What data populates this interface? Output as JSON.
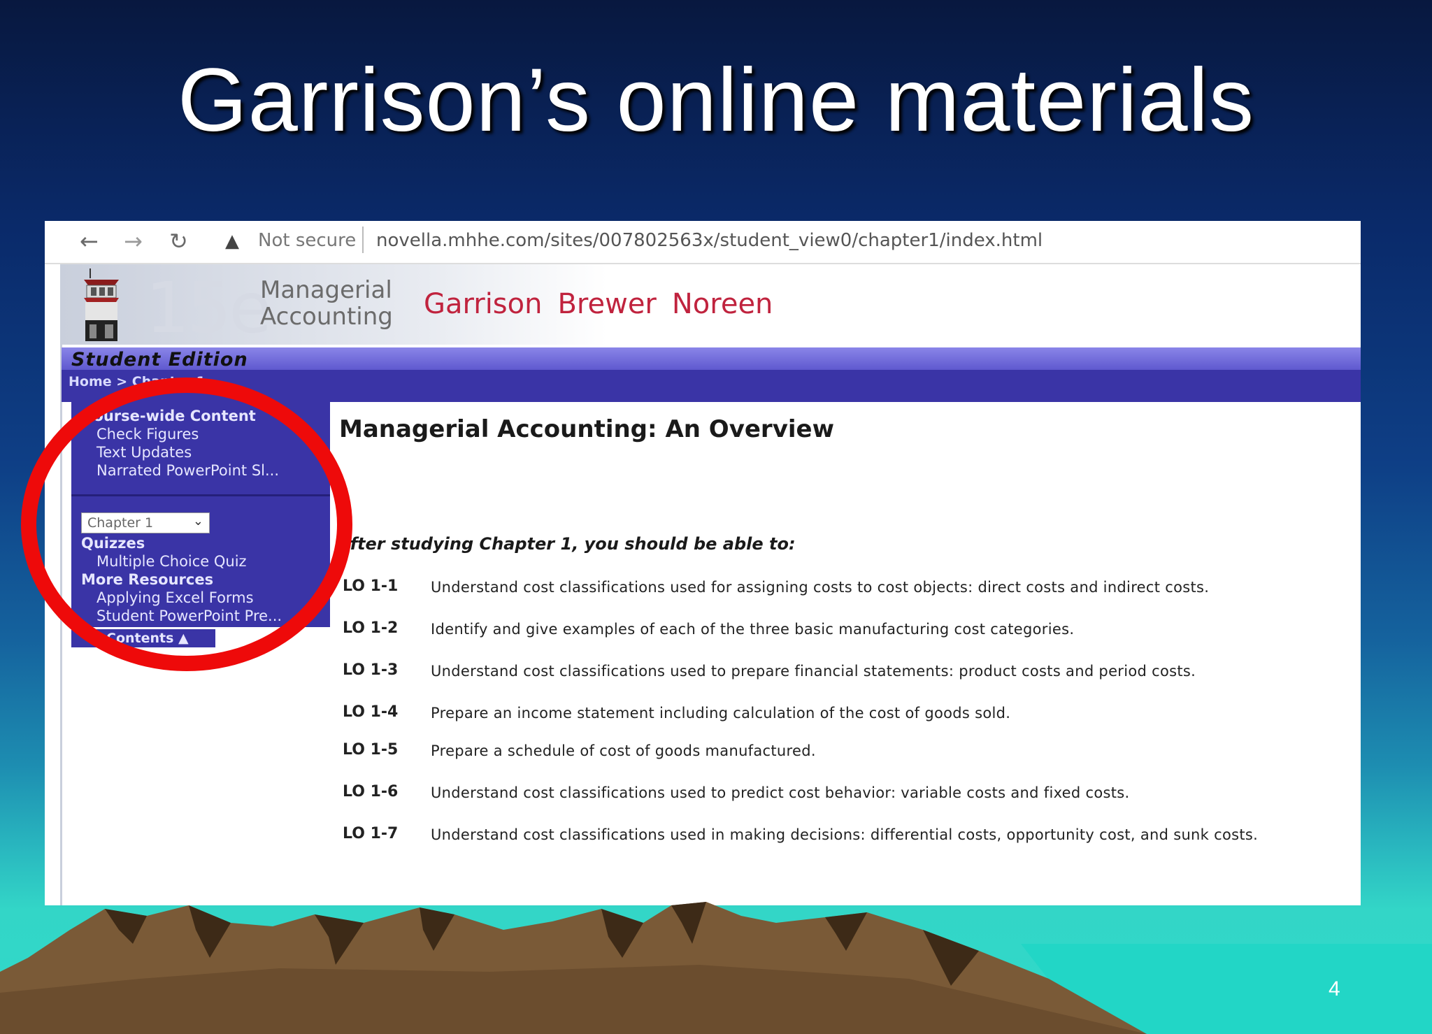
{
  "slide": {
    "title": "Garrison’s online materials",
    "page_number": "4"
  },
  "browser": {
    "back_icon": "arrow-left-icon",
    "forward_icon": "arrow-right-icon",
    "reload_icon": "reload-icon",
    "warning_icon": "warning-triangle-icon",
    "security_label": "Not secure",
    "url": "novella.mhhe.com/sites/007802563x/student_view0/chapter1/index.html"
  },
  "header": {
    "edition_mark": "15e",
    "book_title_line1": "Managerial",
    "book_title_line2": "Accounting",
    "authors": [
      "Garrison",
      "Brewer",
      "Noreen"
    ],
    "edition_label": "Student Edition",
    "breadcrumb": "Home > Chapter 1"
  },
  "sidebar": {
    "course_wide_heading": "Course-wide Content",
    "course_wide_items": [
      "Check Figures",
      "Text Updates",
      "Narrated PowerPoint Sl..."
    ],
    "chapter_select_value": "Chapter 1",
    "quizzes_heading": "Quizzes",
    "quizzes_items": [
      "Multiple Choice Quiz"
    ],
    "more_heading": "More Resources",
    "more_items": [
      "Applying Excel Forms",
      "Student PowerPoint Pre..."
    ],
    "contents_label": "Contents ▲"
  },
  "main": {
    "title": "Managerial Accounting: An Overview",
    "intro": "After studying Chapter 1, you should be able to:",
    "objectives": [
      {
        "code": "LO 1-1",
        "text": "Understand cost classifications used for assigning costs to cost objects: direct costs and indirect costs."
      },
      {
        "code": "LO 1-2",
        "text": "Identify and give examples of each of the three basic manufacturing cost categories."
      },
      {
        "code": "LO 1-3",
        "text": "Understand cost classifications used to prepare financial statements: product costs and period costs."
      },
      {
        "code": "LO 1-4",
        "text": "Prepare an income statement including calculation of the cost of goods sold."
      },
      {
        "code": "LO 1-5",
        "text": "Prepare a schedule of cost of goods manufactured."
      },
      {
        "code": "LO 1-6",
        "text": "Understand cost classifications used to predict cost behavior: variable costs and fixed costs."
      },
      {
        "code": "LO 1-7",
        "text": "Understand cost classifications used in making decisions: differential costs, opportunity cost, and sunk costs."
      }
    ]
  },
  "colors": {
    "highlight_circle": "#ee0a0a",
    "author_red": "#c0233e",
    "sidebar_blue": "#3a34a6"
  }
}
